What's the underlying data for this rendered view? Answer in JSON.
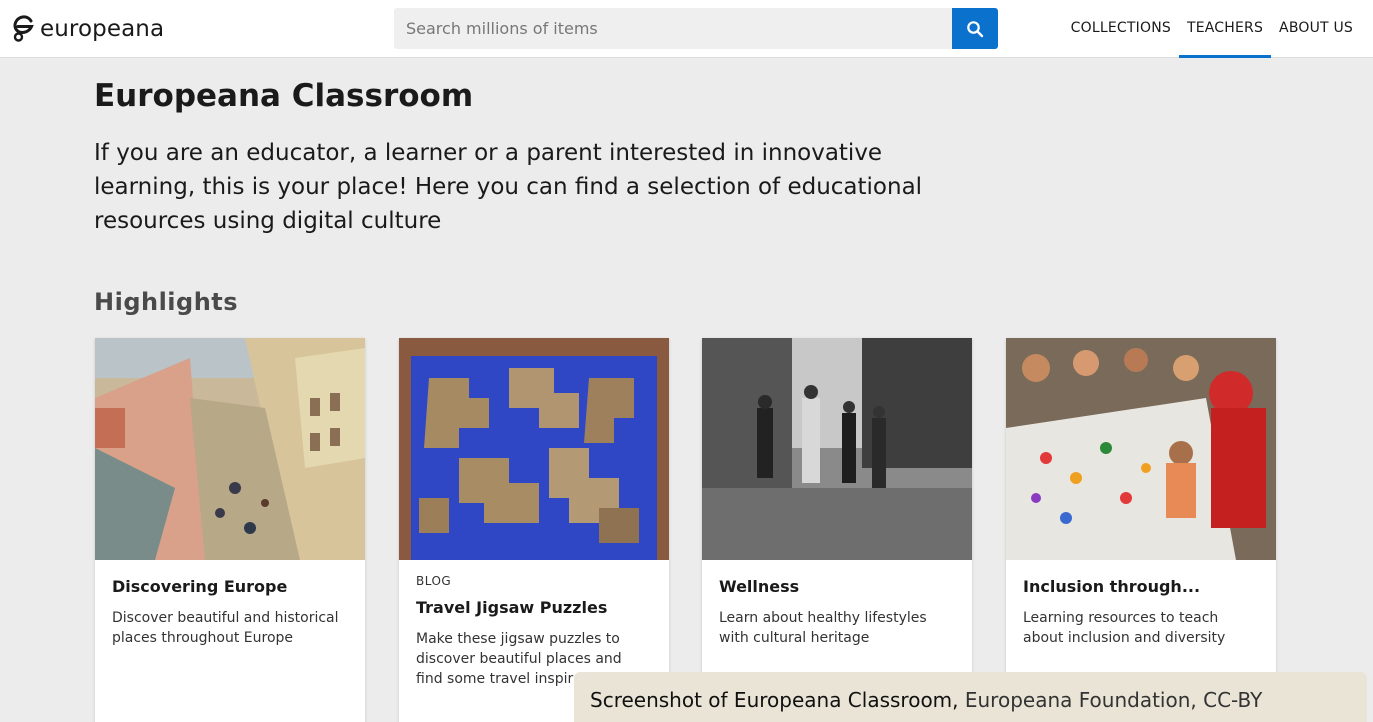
{
  "header": {
    "logo_text": "europeana",
    "search_placeholder": "Search millions of items",
    "nav": [
      {
        "label": "COLLECTIONS",
        "active": false
      },
      {
        "label": "TEACHERS",
        "active": true
      },
      {
        "label": "ABOUT US",
        "active": false
      }
    ]
  },
  "hero": {
    "title": "Europeana Classroom",
    "intro": "If you are an educator, a learner or a parent interested in innovative learning, this is your place! Here you can find a selection of educational resources using digital culture"
  },
  "highlights": {
    "heading": "Highlights",
    "cards": [
      {
        "tag": "",
        "title": "Discovering Europe",
        "description": "Discover beautiful and historical places throughout Europe",
        "image": "painting-street-scene"
      },
      {
        "tag": "BLOG",
        "title": "Travel Jigsaw Puzzles",
        "description": "Make these jigsaw puzzles to discover beautiful places and find some travel inspiration",
        "image": "jigsaw-map"
      },
      {
        "tag": "",
        "title": "Wellness",
        "description": "Learn about healthy lifestyles with cultural heritage",
        "image": "bw-runners-photo"
      },
      {
        "tag": "",
        "title": "Inclusion through...",
        "description": "Learning resources to teach about inclusion and diversity",
        "image": "children-painting-photo"
      }
    ]
  },
  "caption": {
    "bold": "Screenshot of Europeana Classroom,",
    "rest": " Europeana Foundation, CC-BY"
  },
  "colors": {
    "accent": "#0a72cc",
    "background": "#ececec"
  }
}
